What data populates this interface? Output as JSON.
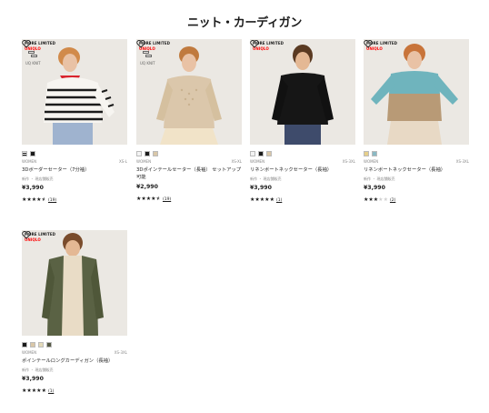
{
  "page": {
    "title": "ニット・カーディガン"
  },
  "tags": {
    "online": "MORE LIMITED",
    "brand": "UNIQLO",
    "ufw_label": "UQ KNIT"
  },
  "colors": {
    "accent_red": "#ff0000",
    "text": "#1b1b1b",
    "muted": "#888888",
    "star_off": "#cfcfcf"
  },
  "products": [
    {
      "name": "3Dボーダーセーター（7分袖）",
      "gender": "WOMEN",
      "size": "XS-L",
      "note": "新作 ・ 現店舗販売",
      "price": "¥3,990",
      "rating_value": 4.5,
      "review_count": "(19)",
      "swatches": [
        "#1b1b1b",
        "#f3f3f3"
      ],
      "badges": [
        "online",
        "brand",
        "ufw"
      ]
    },
    {
      "name": "3Dポインテールセーター（長袖） セットアップ可能",
      "gender": "WOMEN",
      "size": "XS-XL",
      "note": "新作 ・ 現店舗販売",
      "price": "¥2,990",
      "rating_value": 4.5,
      "review_count": "(19)",
      "swatches": [
        "#f3f3f3",
        "#1b1b1b",
        "#d9c7a8"
      ],
      "badges": [
        "online",
        "brand",
        "ufw"
      ]
    },
    {
      "name": "リネンボートネックセーター（長袖）",
      "gender": "WOMEN",
      "size": "XS-3XL",
      "note": "新作 ・ 現店舗販売",
      "price": "¥3,990",
      "rating_value": 5,
      "review_count": "(1)",
      "swatches": [
        "#f3f3f3",
        "#1b1b1b",
        "#d9c7a8"
      ],
      "badges": [
        "online",
        "brand"
      ]
    },
    {
      "name": "リネンボートネックセーター（長袖）",
      "gender": "WOMEN",
      "size": "XS-3XL",
      "note": "新作 ・ 現店舗販売",
      "price": "¥3,990",
      "rating_value": 3,
      "review_count": "(2)",
      "swatches": [
        "#e6cf8a",
        "#8ab9c4"
      ],
      "badges": [
        "online",
        "brand"
      ]
    },
    {
      "name": "ポインテールロングカーディガン（長袖）",
      "gender": "WOMEN",
      "size": "XS-3XL",
      "note": "新作 ・ 現店舗販売",
      "price": "¥3,990",
      "rating_value": 5,
      "review_count": "(1)",
      "swatches": [
        "#1b1b1b",
        "#d9c7a8",
        "#e3d9b8",
        "#555944"
      ],
      "badges": [
        "online",
        "brand"
      ]
    }
  ]
}
